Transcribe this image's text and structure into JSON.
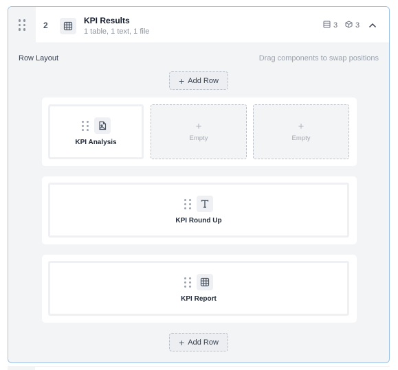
{
  "section": {
    "number": "2",
    "title": "KPI Results",
    "subtitle": "1 table, 1 text, 1 file",
    "stats": [
      {
        "icon": "rows-icon",
        "value": "3"
      },
      {
        "icon": "cube-icon",
        "value": "3"
      }
    ],
    "collapse_icon": "chevron-up-icon"
  },
  "layout": {
    "label": "Row Layout",
    "hint": "Drag components to swap positions",
    "add_row_label": "Add Row",
    "rows": [
      {
        "slots": [
          {
            "type": "component",
            "label": "KPI Analysis",
            "icon": "file-image-icon"
          },
          {
            "type": "empty",
            "label": "Empty"
          },
          {
            "type": "empty",
            "label": "Empty"
          }
        ]
      },
      {
        "slots": [
          {
            "type": "component",
            "label": "KPI Round Up",
            "icon": "text-icon"
          }
        ]
      },
      {
        "slots": [
          {
            "type": "component",
            "label": "KPI Report",
            "icon": "table-icon"
          }
        ]
      }
    ]
  },
  "colors": {
    "card_border": "#9ec4e6",
    "card_background": "#f3f4f6",
    "text_primary": "#111827",
    "text_muted": "#9ca3af"
  }
}
